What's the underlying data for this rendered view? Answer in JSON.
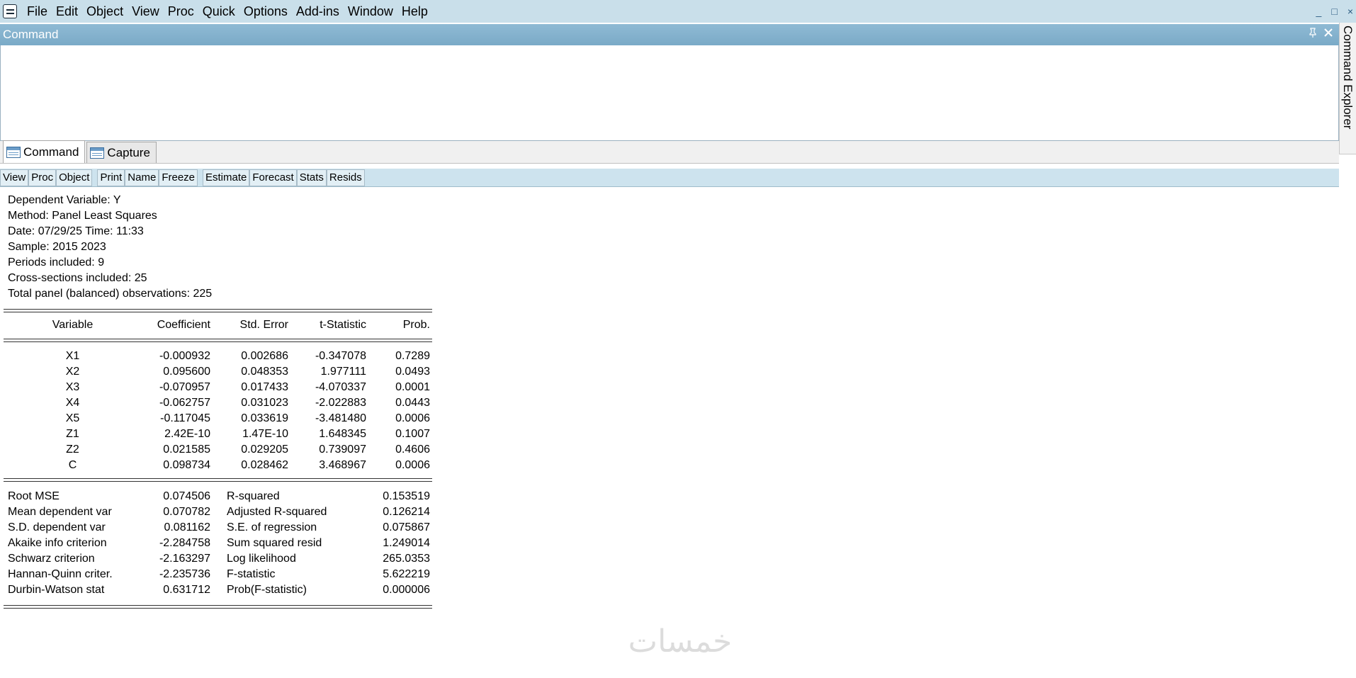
{
  "menubar": {
    "items": [
      "File",
      "Edit",
      "Object",
      "View",
      "Proc",
      "Quick",
      "Options",
      "Add-ins",
      "Window",
      "Help"
    ],
    "controls": [
      "_",
      "□",
      "×"
    ]
  },
  "command_window": {
    "title": "Command",
    "pin_icon": "pin-icon",
    "close_icon": "close-icon",
    "pin_glyph": "📌",
    "close_glyph": "✕"
  },
  "side_panel": {
    "label": "Command Explorer"
  },
  "tabs": [
    {
      "label": "Command",
      "icon": "table-icon"
    },
    {
      "label": "Capture",
      "icon": "table-icon"
    }
  ],
  "toolbar": {
    "group1": [
      "View",
      "Proc",
      "Object"
    ],
    "group2": [
      "Print",
      "Name",
      "Freeze"
    ],
    "group3": [
      "Estimate",
      "Forecast",
      "Stats",
      "Resids"
    ]
  },
  "output": {
    "header": [
      "Dependent Variable: Y",
      "Method: Panel Least Squares",
      "Date: 07/29/25   Time: 11:33",
      "Sample: 2015 2023",
      "Periods included: 9",
      "Cross-sections included: 25",
      "Total panel (balanced) observations: 225"
    ],
    "columns": [
      "Variable",
      "Coefficient",
      "Std. Error",
      "t-Statistic",
      "Prob."
    ],
    "rows": [
      [
        "X1",
        "-0.000932",
        "0.002686",
        "-0.347078",
        "0.7289"
      ],
      [
        "X2",
        "0.095600",
        "0.048353",
        "1.977111",
        "0.0493"
      ],
      [
        "X3",
        "-0.070957",
        "0.017433",
        "-4.070337",
        "0.0001"
      ],
      [
        "X4",
        "-0.062757",
        "0.031023",
        "-2.022883",
        "0.0443"
      ],
      [
        "X5",
        "-0.117045",
        "0.033619",
        "-3.481480",
        "0.0006"
      ],
      [
        "Z1",
        "2.42E-10",
        "1.47E-10",
        "1.648345",
        "0.1007"
      ],
      [
        "Z2",
        "0.021585",
        "0.029205",
        "0.739097",
        "0.4606"
      ],
      [
        "C",
        "0.098734",
        "0.028462",
        "3.468967",
        "0.0006"
      ]
    ],
    "stats": [
      [
        "Root MSE",
        "0.074506",
        "R-squared",
        "0.153519"
      ],
      [
        "Mean dependent var",
        "0.070782",
        "Adjusted R-squared",
        "0.126214"
      ],
      [
        "S.D. dependent var",
        "0.081162",
        "S.E. of regression",
        "0.075867"
      ],
      [
        "Akaike info criterion",
        "-2.284758",
        "Sum squared resid",
        "1.249014"
      ],
      [
        "Schwarz criterion",
        "-2.163297",
        "Log likelihood",
        "265.0353"
      ],
      [
        "Hannan-Quinn criter.",
        "-2.235736",
        "F-statistic",
        "5.622219"
      ],
      [
        "Durbin-Watson stat",
        "0.631712",
        "Prob(F-statistic)",
        "0.000006"
      ]
    ]
  },
  "watermark": "خمسات"
}
